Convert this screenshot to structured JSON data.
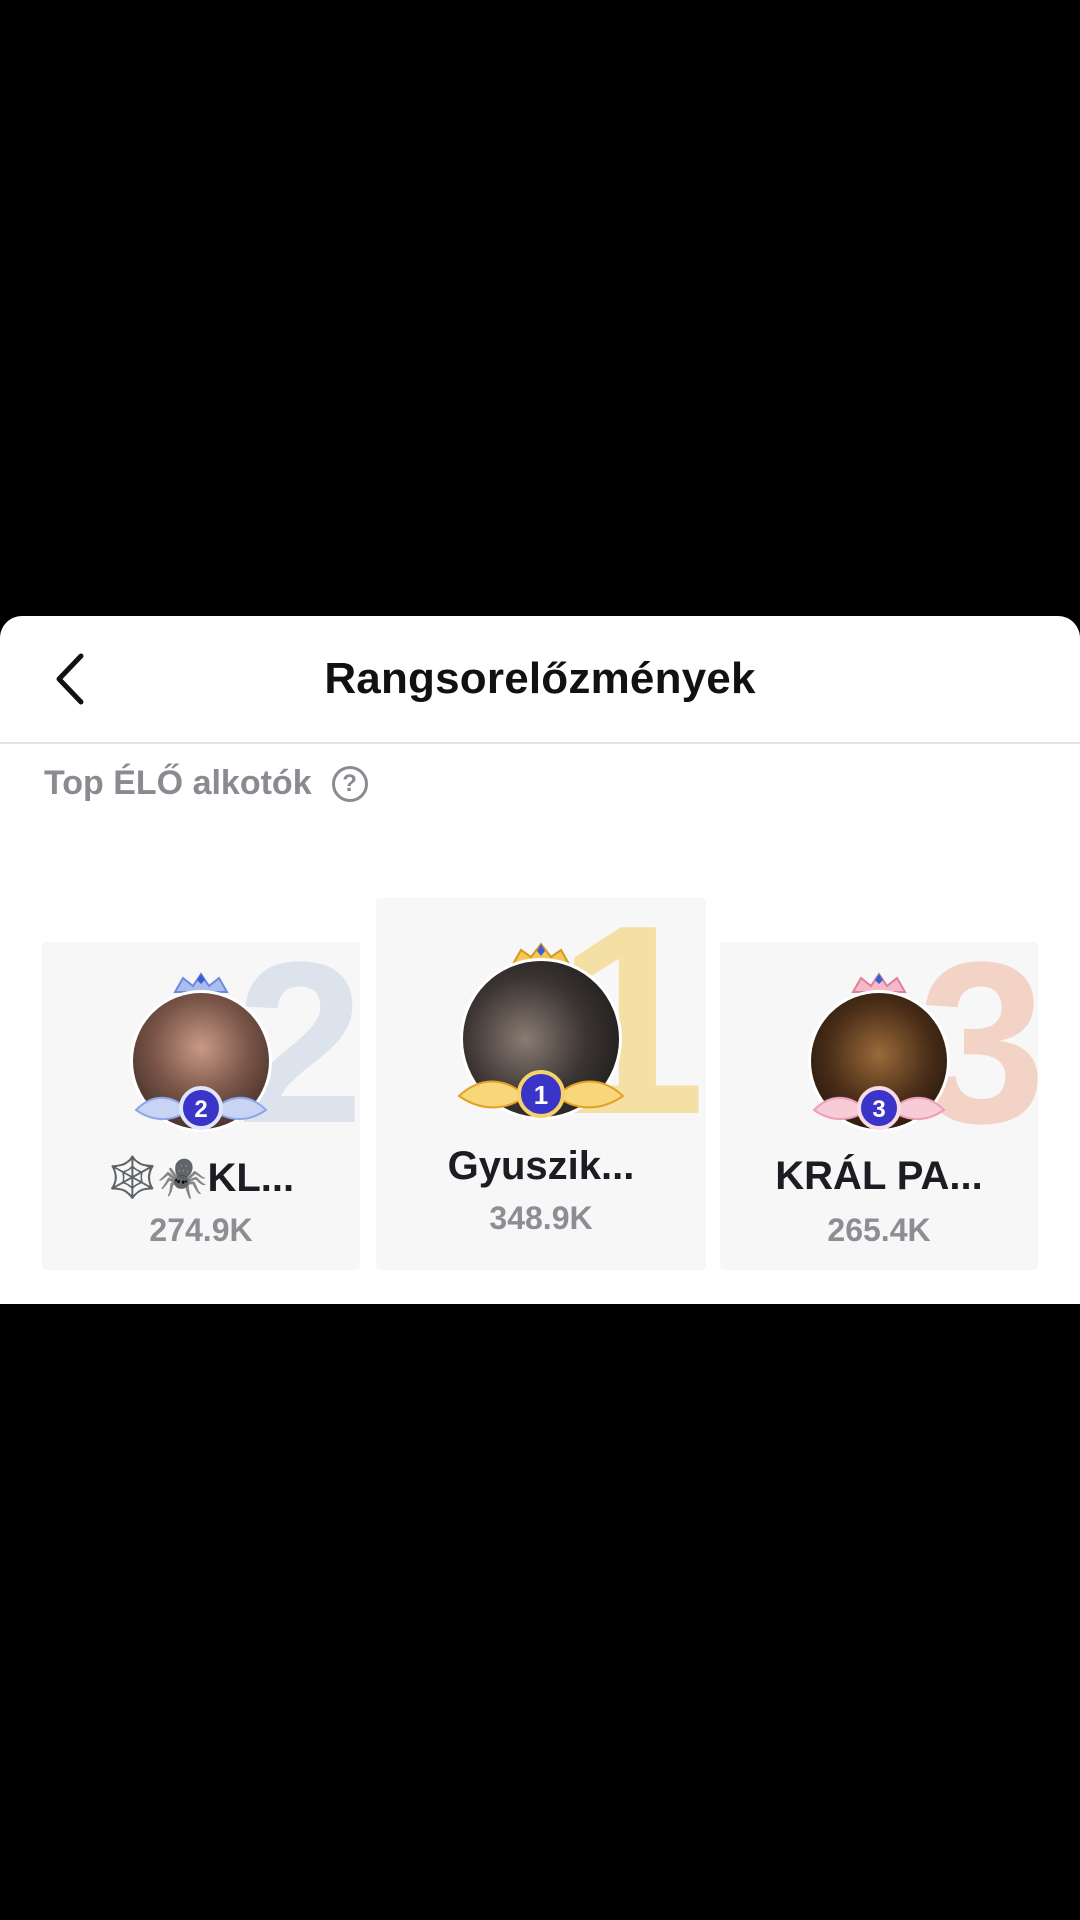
{
  "header": {
    "title": "Rangsorelőzmények",
    "back_icon": "chevron-left-icon"
  },
  "section": {
    "label": "Top ÉLŐ alkotók",
    "help_icon": "question-circle-icon",
    "help_glyph": "?"
  },
  "leaderboard": [
    {
      "rank": "2",
      "name_prefix": "🕸️🕷️",
      "name": "KL...",
      "score": "274.9K",
      "badge_color": "#8fa7e8"
    },
    {
      "rank": "1",
      "name_prefix": "",
      "name": "Gyuszik...",
      "score": "348.9K",
      "badge_color": "#f0b53a"
    },
    {
      "rank": "3",
      "name_prefix": "",
      "name": "KRÁL PA...",
      "score": "265.4K",
      "badge_color": "#ef9fb8"
    }
  ]
}
